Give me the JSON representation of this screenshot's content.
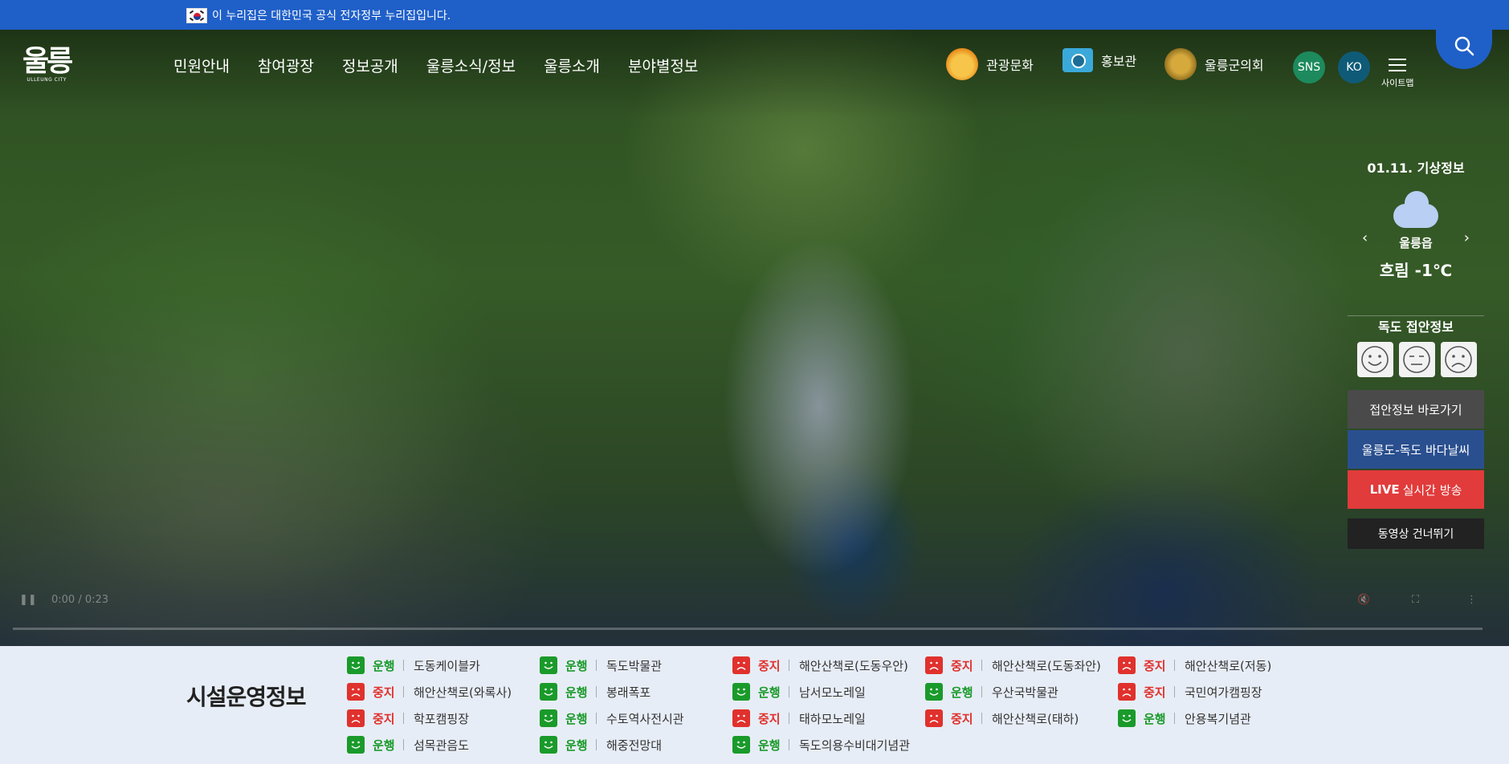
{
  "gov_banner": {
    "text": "이 누리집은 대한민국 공식 전자정부 누리집입니다."
  },
  "logo": {
    "main": "울릉",
    "sub": "ULLEUNG CITY"
  },
  "gnb": [
    "민원안내",
    "참여광장",
    "정보공개",
    "울릉소식/정보",
    "울릉소개",
    "분야별정보"
  ],
  "quick_links": [
    {
      "label": "관광문화",
      "icon": "mascot-icon"
    },
    {
      "label": "홍보관",
      "icon": "camera-icon"
    },
    {
      "label": "울릉군의회",
      "icon": "council-seal-icon"
    }
  ],
  "sns": "SNS",
  "lang": "KO",
  "sitemap": "사이트맵",
  "weather": {
    "date": "01.11. 기상정보",
    "place": "울릉읍",
    "temp": "흐림 -1℃",
    "icon": "cloud-icon"
  },
  "dokdo": {
    "title": "독도 접안정보",
    "btn_access": "접안정보 바로가기",
    "btn_sea": "울릉도-독도 바다날씨",
    "btn_live_strong": "LIVE",
    "btn_live_rest": "실시간 방송",
    "btn_skip": "동영상 건너뛰기"
  },
  "video": {
    "time": "0:00 / 0:23"
  },
  "colors": {
    "gov_blue": "#1f5fc8",
    "run_green": "#1a9a2b",
    "stop_red": "#e0312d",
    "sea_blue": "#2a4f8f",
    "live_red": "#e13b3b",
    "sns_green": "#1d8a5d",
    "ko_teal": "#0f5b77"
  },
  "facility": {
    "title": "시설운영정보",
    "items": [
      {
        "status": "운행",
        "name": "도동케이블카"
      },
      {
        "status": "운행",
        "name": "독도박물관"
      },
      {
        "status": "중지",
        "name": "해안산책로(도동우안)"
      },
      {
        "status": "중지",
        "name": "해안산책로(도동좌안)"
      },
      {
        "status": "중지",
        "name": "해안산책로(저동)"
      },
      {
        "status": "중지",
        "name": "해안산책로(와록사)"
      },
      {
        "status": "운행",
        "name": "봉래폭포"
      },
      {
        "status": "운행",
        "name": "남서모노레일"
      },
      {
        "status": "운행",
        "name": "우산국박물관"
      },
      {
        "status": "중지",
        "name": "국민여가캠핑장"
      },
      {
        "status": "중지",
        "name": "학포캠핑장"
      },
      {
        "status": "운행",
        "name": "수토역사전시관"
      },
      {
        "status": "중지",
        "name": "태하모노레일"
      },
      {
        "status": "중지",
        "name": "해안산책로(태하)"
      },
      {
        "status": "운행",
        "name": "안용복기념관"
      },
      {
        "status": "운행",
        "name": "섬목관음도"
      },
      {
        "status": "운행",
        "name": "해중전망대"
      },
      {
        "status": "운행",
        "name": "독도의용수비대기념관"
      }
    ]
  }
}
